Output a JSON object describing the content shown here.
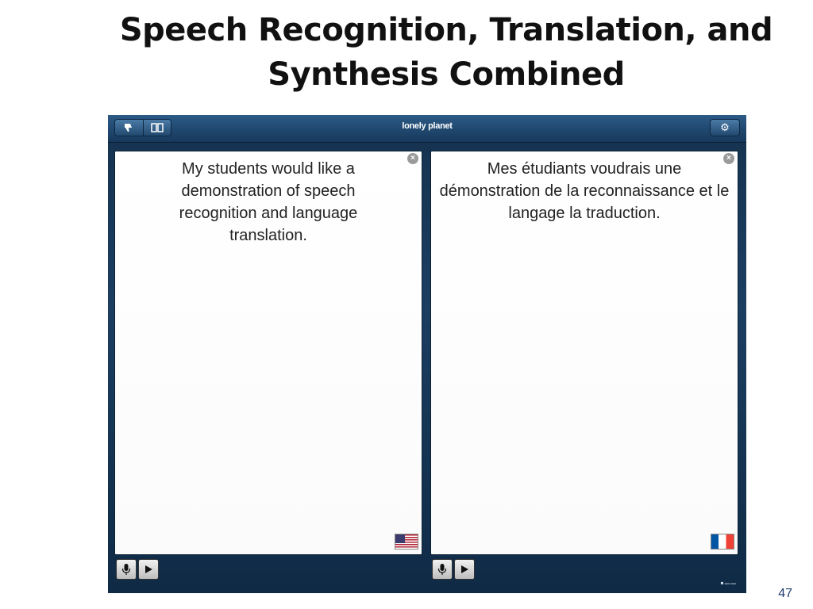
{
  "slide": {
    "title_line1": "Speech Recognition, Translation, and",
    "title_line2": "Synthesis Combined",
    "page_number": "47"
  },
  "app": {
    "logo_text": "lonely planet",
    "icons": {
      "thumb": "thumbs-down-icon",
      "book": "book-icon",
      "settings": "gear-icon",
      "mic": "microphone-icon",
      "play": "play-icon",
      "clear": "clear-icon"
    },
    "left_panel": {
      "text": "My students would like a demonstration of speech recognition and language translation.",
      "flag": "us-flag"
    },
    "right_panel": {
      "text": "Mes étudiants voudrais une démonstration de la reconnaissance et le langage la traduction.",
      "flag": "fr-flag"
    }
  }
}
